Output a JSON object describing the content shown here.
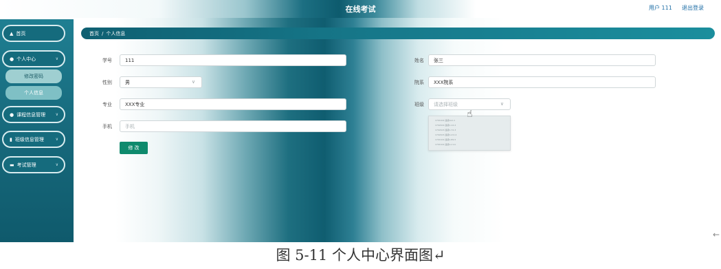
{
  "header": {
    "title": "在线考试",
    "user_label": "用户 111",
    "logout_label": "退出登录"
  },
  "sidebar": {
    "items": [
      {
        "label": "首页",
        "icon": "home-icon"
      },
      {
        "label": "个人中心",
        "icon": "user-icon"
      },
      {
        "label": "课程信息管理",
        "icon": "user-icon"
      },
      {
        "label": "班级信息管理",
        "icon": "clipboard-icon"
      },
      {
        "label": "考试管理",
        "icon": "stack-icon"
      }
    ],
    "sub_items": [
      {
        "label": "修改密码"
      },
      {
        "label": "个人信息"
      }
    ]
  },
  "breadcrumb": {
    "home": "首页",
    "separator": "/",
    "current": "个人信息"
  },
  "form": {
    "student_id": {
      "label": "学号",
      "value": "111"
    },
    "gender": {
      "label": "性别",
      "value": "男"
    },
    "major": {
      "label": "专业",
      "value": "XXX专业"
    },
    "phone": {
      "label": "手机",
      "placeholder": "手机"
    },
    "name": {
      "label": "姓名",
      "value": "张三"
    },
    "department": {
      "label": "院系",
      "value": "XXX院系"
    },
    "class": {
      "label": "班级",
      "placeholder": "请选择班级"
    },
    "save_label": "修 改"
  },
  "dropdown_options": [
    "1701102-班级1a1-1",
    "1702102-班级1-12-2",
    "1702103-班级1-72-3",
    "1702103-班级1-m2-4",
    "1701102-班级1-89-5",
    "1701102-班级1-n1-b"
  ],
  "caption": "图 5-11 个人中心界面图↵",
  "margin_mark": "←",
  "colors": {
    "sidebar": "#17697c",
    "accent": "#0f8a6d",
    "link": "#1e6ea6"
  }
}
